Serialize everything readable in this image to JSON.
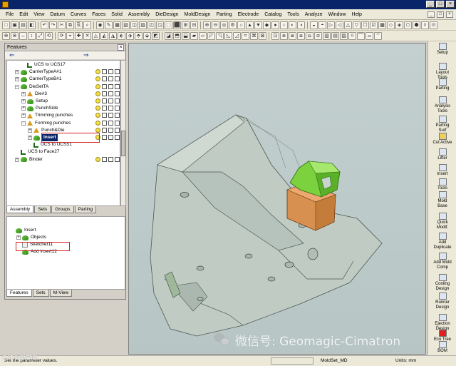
{
  "menubar": {
    "items": [
      "File",
      "Edit",
      "View",
      "Datum",
      "Curves",
      "Faces",
      "Solid",
      "Assembly",
      "DieDesign",
      "MoldDesign",
      "Parting",
      "Electrode",
      "Catalog",
      "Tools",
      "Analyze",
      "Window",
      "Help"
    ]
  },
  "features_panel": {
    "title": "Features",
    "tree": [
      {
        "label": "UCS to UCS17",
        "icon": "ucs-icon",
        "indent": 2,
        "expander": ""
      },
      {
        "label": "CarrierTypeA#1",
        "icon": "part-icon",
        "indent": 1,
        "expander": "+"
      },
      {
        "label": "CarrierTypeB#1",
        "icon": "part-icon",
        "indent": 1,
        "expander": "+"
      },
      {
        "label": "DieSetTA",
        "icon": "part-icon",
        "indent": 1,
        "expander": "-"
      },
      {
        "label": "Die#3",
        "icon": "sub-part-icon",
        "indent": 2,
        "expander": "+"
      },
      {
        "label": "Setup",
        "icon": "part-icon",
        "indent": 2,
        "expander": "+"
      },
      {
        "label": "PunchSide",
        "icon": "part-icon",
        "indent": 2,
        "expander": "+"
      },
      {
        "label": "Trimming punches",
        "icon": "sub-part-icon",
        "indent": 2,
        "expander": "+"
      },
      {
        "label": "Forming punches",
        "icon": "sub-part-icon",
        "indent": 2,
        "expander": "-"
      },
      {
        "label": "Punch&Die",
        "icon": "sub-part-icon",
        "indent": 3,
        "expander": "+"
      },
      {
        "label": "Insert",
        "icon": "part-icon",
        "indent": 3,
        "expander": "+"
      },
      {
        "label": "UCS to UCS51",
        "icon": "ucs-icon",
        "indent": 3,
        "expander": ""
      },
      {
        "label": "UCS to Face27",
        "icon": "ucs-icon",
        "indent": 1,
        "expander": ""
      },
      {
        "label": "Binder",
        "icon": "part-icon",
        "indent": 1,
        "expander": "+"
      }
    ],
    "tabs": [
      "Assembly",
      "Sets",
      "Groups",
      "Parting"
    ],
    "active_tab": "Assembly"
  },
  "lower_panel": {
    "tree": [
      {
        "label": "Insert",
        "indent": 0,
        "expander": ""
      },
      {
        "label": "Objects",
        "indent": 1,
        "expander": "+"
      },
      {
        "label": "Sketcher11",
        "indent": 1,
        "expander": ""
      },
      {
        "label": "Add Insert12",
        "indent": 1,
        "expander": ""
      }
    ],
    "tabs": [
      "Features",
      "Sets",
      "M-View"
    ],
    "active_tab": "Features"
  },
  "right_toolbar": {
    "items": [
      "Setup",
      "Layout\nTools",
      "Parting",
      "Analysis\nTools",
      "Parting\nSurf",
      "Cut Active",
      "Lifter",
      "Insert",
      "Tools",
      "Mold\nBase",
      "Quick\nModif.",
      "Add\nDuplicate",
      "Add Mold\nComp",
      "Cooling\nDesign",
      "Runner\nDesign",
      "Ejection\nDesign",
      "Eco Tree",
      "BOM"
    ]
  },
  "status": {
    "hint": "Set the parameter values.",
    "file": "MoldSet_MD",
    "units": "Units: mm"
  },
  "watermark": {
    "text": "微信号: Geomagic-Cimatron",
    "left": "CAD外部学院"
  },
  "colors": {
    "title_bar": "#0a246a",
    "insert_green": "#7bd23e",
    "insert_orange": "#d89050",
    "highlight": "#d42020"
  }
}
